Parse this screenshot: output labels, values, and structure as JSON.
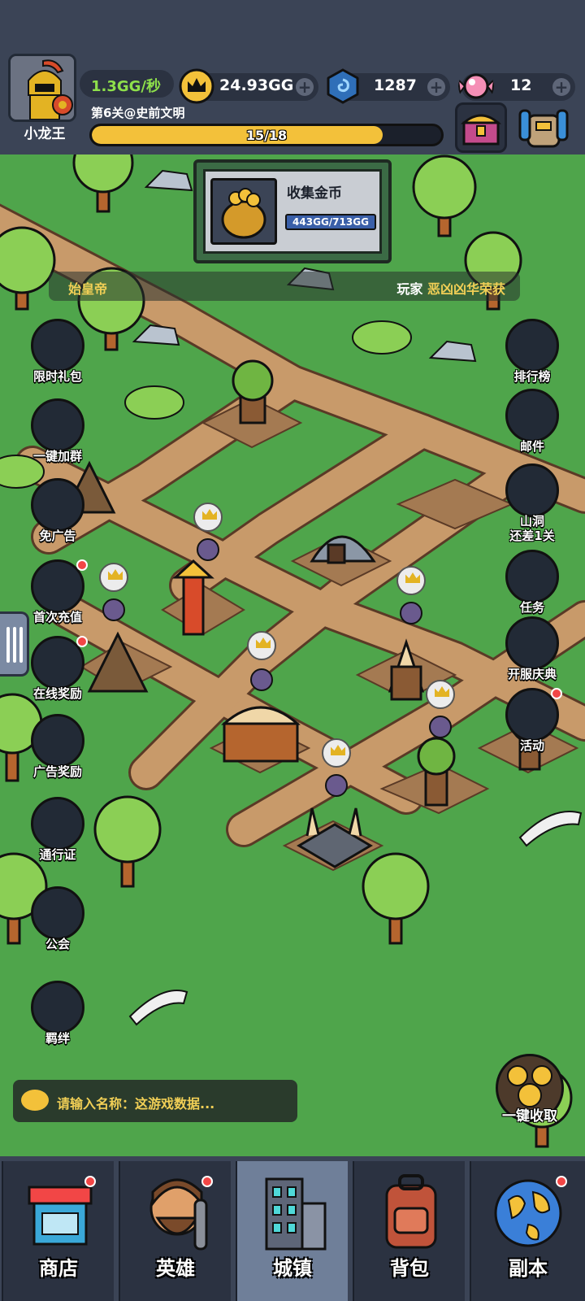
{
  "player": {
    "name": "小龙王",
    "avatar_icon": "spartan-warrior-icon"
  },
  "resources": {
    "rate": "1.3GG/秒",
    "gold": "24.93GG",
    "gems": "1287",
    "candy": "12"
  },
  "stage": {
    "label": "第6关@史前文明",
    "progress_text": "15/18",
    "progress_fraction": 0.833
  },
  "collect": {
    "title": "收集金币",
    "amount": "443GG/713GG"
  },
  "marquee": {
    "left": "始皇帝",
    "right_player": "玩家",
    "right_text": "恶凶凶华荣获"
  },
  "left_buttons": [
    {
      "label": "限时礼包",
      "icon": "tent-gift-icon",
      "dot": false
    },
    {
      "label": "一键加群",
      "icon": "penguin-icon",
      "dot": false
    },
    {
      "label": "免广告",
      "icon": "no-ads-icon",
      "dot": false
    },
    {
      "label": "首次充值",
      "icon": "gold-chest-icon",
      "dot": true
    },
    {
      "label": "在线奖励",
      "icon": "online-chest-icon",
      "dot": true
    },
    {
      "label": "广告奖励",
      "icon": "ad-chest-icon",
      "dot": false
    },
    {
      "label": "通行证",
      "icon": "pass-icon",
      "dot": false
    },
    {
      "label": "公会",
      "icon": "castle-icon",
      "dot": false
    },
    {
      "label": "羁绊",
      "icon": "bond-icon",
      "dot": false
    }
  ],
  "right_buttons": [
    {
      "label": "排行榜",
      "label2": "",
      "icon": "trophy-icon",
      "dot": false
    },
    {
      "label": "邮件",
      "label2": "",
      "icon": "mail-icon",
      "dot": false
    },
    {
      "label": "山洞",
      "label2": "还差1关",
      "icon": "cave-egg-icon",
      "dot": false
    },
    {
      "label": "任务",
      "label2": "",
      "icon": "clipboard-icon",
      "dot": false
    },
    {
      "label": "开服庆典",
      "label2": "",
      "icon": "map-scroll-icon",
      "dot": false
    },
    {
      "label": "活动",
      "label2": "",
      "icon": "party-hat-icon",
      "dot": true
    }
  ],
  "chat": {
    "text": "请输入名称：这游戏数据..."
  },
  "collect_all": {
    "label": "一键收取"
  },
  "nav": [
    {
      "label": "商店",
      "icon": "shop-icon",
      "dot": true,
      "active": false
    },
    {
      "label": "英雄",
      "icon": "caveman-hero-icon",
      "dot": true,
      "active": false
    },
    {
      "label": "城镇",
      "icon": "town-buildings-icon",
      "dot": false,
      "active": true
    },
    {
      "label": "背包",
      "icon": "backpack-icon",
      "dot": false,
      "active": false
    },
    {
      "label": "副本",
      "icon": "globe-icon",
      "dot": true,
      "active": false
    }
  ],
  "colors": {
    "grass": "#4fa54b",
    "path": "#c89a6a",
    "topbar": "#3b4456",
    "accent_gold": "#f3c13a",
    "notification_red": "#f24646"
  }
}
